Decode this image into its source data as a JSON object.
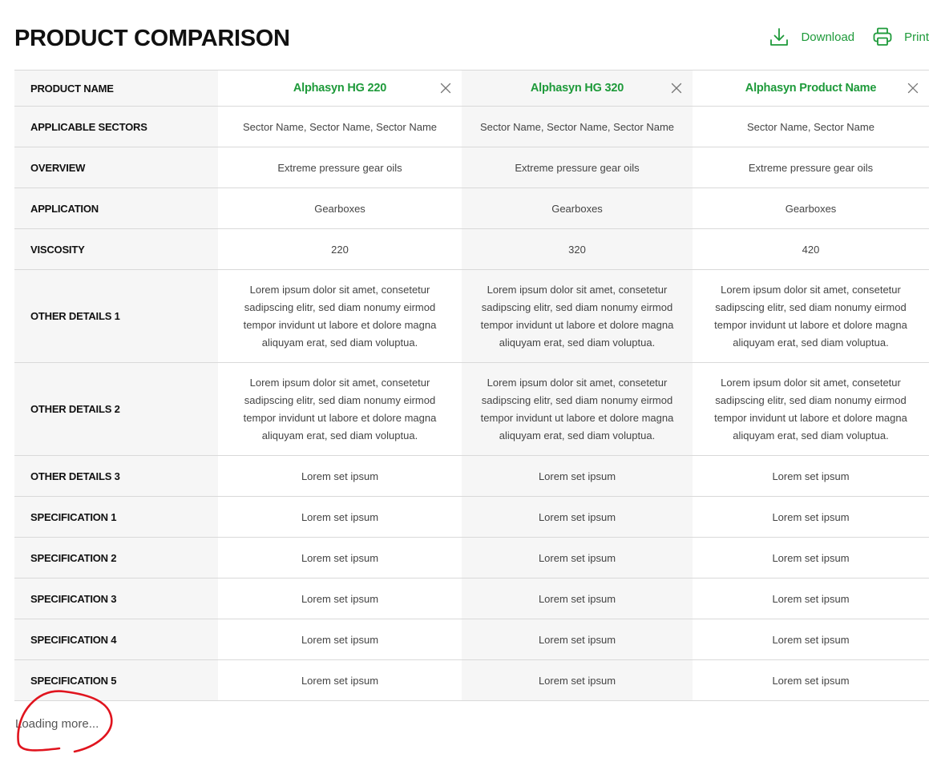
{
  "page": {
    "title": "PRODUCT COMPARISON",
    "loading_text": "Loading more...",
    "accent_color": "#1e9a3a",
    "annotation_color": "#e0141e"
  },
  "toolbar": {
    "download_label": "Download",
    "download_icon": "download-icon",
    "print_label": "Print",
    "print_icon": "printer-icon"
  },
  "comparison": {
    "header_label": "PRODUCT NAME",
    "products": [
      {
        "name": "Alphasyn HG 220"
      },
      {
        "name": "Alphasyn HG 320"
      },
      {
        "name": "Alphasyn Product Name"
      }
    ],
    "rows": [
      {
        "label": "APPLICABLE SECTORS",
        "values": [
          "Sector Name, Sector Name, Sector Name",
          "Sector Name, Sector Name, Sector Name",
          "Sector Name, Sector Name"
        ]
      },
      {
        "label": "OVERVIEW",
        "values": [
          "Extreme pressure gear oils",
          "Extreme pressure gear oils",
          "Extreme pressure gear oils"
        ]
      },
      {
        "label": "APPLICATION",
        "values": [
          "Gearboxes",
          "Gearboxes",
          "Gearboxes"
        ]
      },
      {
        "label": "VISCOSITY",
        "values": [
          "220",
          "320",
          "420"
        ]
      },
      {
        "label": "OTHER DETAILS 1",
        "values": [
          [
            "Lorem ipsum dolor sit amet, consetetur",
            "sadipscing elitr, sed diam nonumy eirmod",
            "tempor invidunt ut labore et dolore magna",
            "aliquyam erat, sed diam voluptua."
          ],
          [
            "Lorem ipsum dolor sit amet, consetetur",
            "sadipscing elitr, sed diam nonumy eirmod",
            "tempor invidunt ut labore et dolore magna",
            "aliquyam erat, sed diam voluptua."
          ],
          [
            "Lorem ipsum dolor sit amet, consetetur",
            "sadipscing elitr, sed diam nonumy eirmod",
            "tempor invidunt ut labore et dolore magna",
            "aliquyam erat, sed diam voluptua."
          ]
        ]
      },
      {
        "label": "OTHER DETAILS 2",
        "values": [
          [
            "Lorem ipsum dolor sit amet, consetetur",
            "sadipscing elitr, sed diam nonumy eirmod",
            "tempor invidunt ut labore et dolore magna",
            "aliquyam erat, sed diam voluptua."
          ],
          [
            "Lorem ipsum dolor sit amet, consetetur",
            "sadipscing elitr, sed diam nonumy eirmod",
            "tempor invidunt ut labore et dolore magna",
            "aliquyam erat, sed diam voluptua."
          ],
          [
            "Lorem ipsum dolor sit amet, consetetur",
            "sadipscing elitr, sed diam nonumy eirmod",
            "tempor invidunt ut labore et dolore magna",
            "aliquyam erat, sed diam voluptua."
          ]
        ]
      },
      {
        "label": "OTHER DETAILS 3",
        "values": [
          "Lorem set ipsum",
          "Lorem set ipsum",
          "Lorem set ipsum"
        ]
      },
      {
        "label": "SPECIFICATION 1",
        "values": [
          "Lorem set ipsum",
          "Lorem set ipsum",
          "Lorem set ipsum"
        ]
      },
      {
        "label": "SPECIFICATION 2",
        "values": [
          "Lorem set ipsum",
          "Lorem set ipsum",
          "Lorem set ipsum"
        ]
      },
      {
        "label": "SPECIFICATION 3",
        "values": [
          "Lorem set ipsum",
          "Lorem set ipsum",
          "Lorem set ipsum"
        ]
      },
      {
        "label": "SPECIFICATION 4",
        "values": [
          "Lorem set ipsum",
          "Lorem set ipsum",
          "Lorem set ipsum"
        ]
      },
      {
        "label": "SPECIFICATION 5",
        "values": [
          "Lorem set ipsum",
          "Lorem set ipsum",
          "Lorem set ipsum"
        ]
      }
    ]
  }
}
